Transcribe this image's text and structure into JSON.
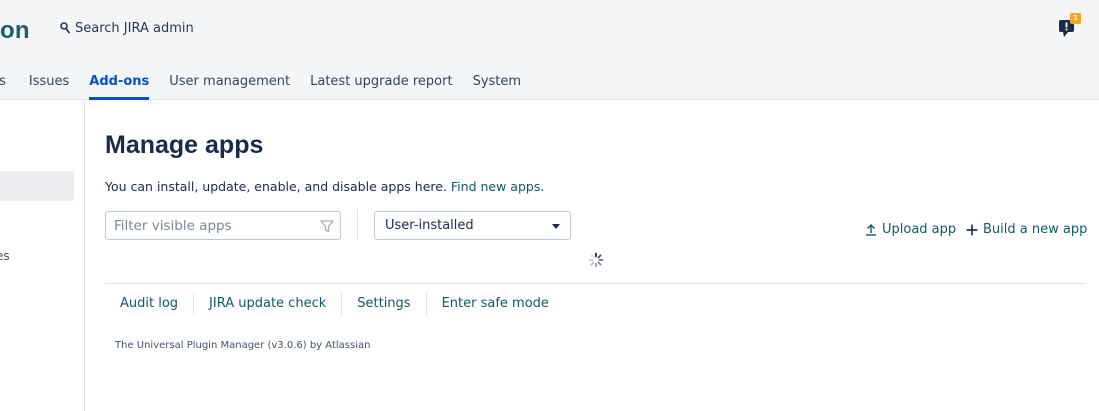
{
  "header": {
    "app_title": "on",
    "search_text": "Search JIRA admin",
    "notification_count": "1"
  },
  "tabs": [
    {
      "label": "ts"
    },
    {
      "label": "Issues"
    },
    {
      "label": "Add-ons"
    },
    {
      "label": "User management"
    },
    {
      "label": "Latest upgrade report"
    },
    {
      "label": "System"
    }
  ],
  "sidebar": {
    "partial_item": "es"
  },
  "main": {
    "title": "Manage apps",
    "description": "You can install, update, enable, and disable apps here.",
    "description_link": "Find new apps.",
    "filter_placeholder": "Filter visible apps",
    "select_value": "User-installed",
    "upload_label": "Upload app",
    "build_label": "Build a new app",
    "links": [
      "Audit log",
      "JIRA update check",
      "Settings",
      "Enter safe mode"
    ],
    "footer_note": "The Universal Plugin Manager (v3.0.6) by Atlassian"
  },
  "colors": {
    "accent": "#0052cc",
    "link": "#0b5b6b",
    "brand_title": "#1a5e73",
    "badge": "#f5a623"
  }
}
